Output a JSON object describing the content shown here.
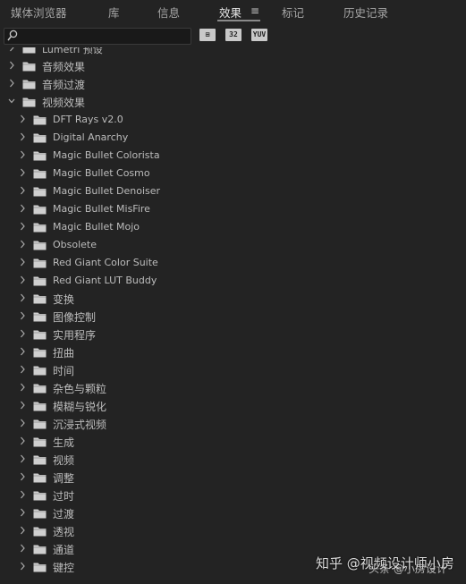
{
  "tabs": [
    {
      "label": "媒体浏览器",
      "active": false
    },
    {
      "label": "库",
      "active": false
    },
    {
      "label": "信息",
      "active": false
    },
    {
      "label": "效果",
      "active": true
    },
    {
      "label": "标记",
      "active": false
    },
    {
      "label": "历史记录",
      "active": false
    }
  ],
  "tab_menu_icon": "≡",
  "search": {
    "value": "",
    "placeholder": ""
  },
  "toolbar_buttons": [
    {
      "label": "⊞",
      "icon": "accelerated-effects-icon"
    },
    {
      "label": "32",
      "icon": "32-bit-color-icon"
    },
    {
      "label": "YUV",
      "icon": "yuv-effects-icon"
    }
  ],
  "tree": [
    {
      "label": "Lumetri 预设",
      "level": 0,
      "expanded": false,
      "cut": true
    },
    {
      "label": "音频效果",
      "level": 0,
      "expanded": false
    },
    {
      "label": "音频过渡",
      "level": 0,
      "expanded": false
    },
    {
      "label": "视频效果",
      "level": 0,
      "expanded": true
    },
    {
      "label": "DFT Rays v2.0",
      "level": 1,
      "expanded": false
    },
    {
      "label": "Digital Anarchy",
      "level": 1,
      "expanded": false
    },
    {
      "label": "Magic Bullet Colorista",
      "level": 1,
      "expanded": false
    },
    {
      "label": "Magic Bullet Cosmo",
      "level": 1,
      "expanded": false
    },
    {
      "label": "Magic Bullet Denoiser",
      "level": 1,
      "expanded": false
    },
    {
      "label": "Magic Bullet MisFire",
      "level": 1,
      "expanded": false
    },
    {
      "label": "Magic Bullet Mojo",
      "level": 1,
      "expanded": false
    },
    {
      "label": "Obsolete",
      "level": 1,
      "expanded": false
    },
    {
      "label": "Red Giant Color Suite",
      "level": 1,
      "expanded": false
    },
    {
      "label": "Red Giant LUT Buddy",
      "level": 1,
      "expanded": false
    },
    {
      "label": "变换",
      "level": 1,
      "expanded": false
    },
    {
      "label": "图像控制",
      "level": 1,
      "expanded": false
    },
    {
      "label": "实用程序",
      "level": 1,
      "expanded": false
    },
    {
      "label": "扭曲",
      "level": 1,
      "expanded": false
    },
    {
      "label": "时间",
      "level": 1,
      "expanded": false
    },
    {
      "label": "杂色与颗粒",
      "level": 1,
      "expanded": false
    },
    {
      "label": "模糊与锐化",
      "level": 1,
      "expanded": false
    },
    {
      "label": "沉浸式视频",
      "level": 1,
      "expanded": false
    },
    {
      "label": "生成",
      "level": 1,
      "expanded": false
    },
    {
      "label": "视频",
      "level": 1,
      "expanded": false
    },
    {
      "label": "调整",
      "level": 1,
      "expanded": false
    },
    {
      "label": "过时",
      "level": 1,
      "expanded": false
    },
    {
      "label": "过渡",
      "level": 1,
      "expanded": false
    },
    {
      "label": "透视",
      "level": 1,
      "expanded": false
    },
    {
      "label": "通道",
      "level": 1,
      "expanded": false
    },
    {
      "label": "键控",
      "level": 1,
      "expanded": false
    }
  ],
  "watermark": "知乎 @视频设计师小房",
  "watermark2": "头条 @小房设计"
}
